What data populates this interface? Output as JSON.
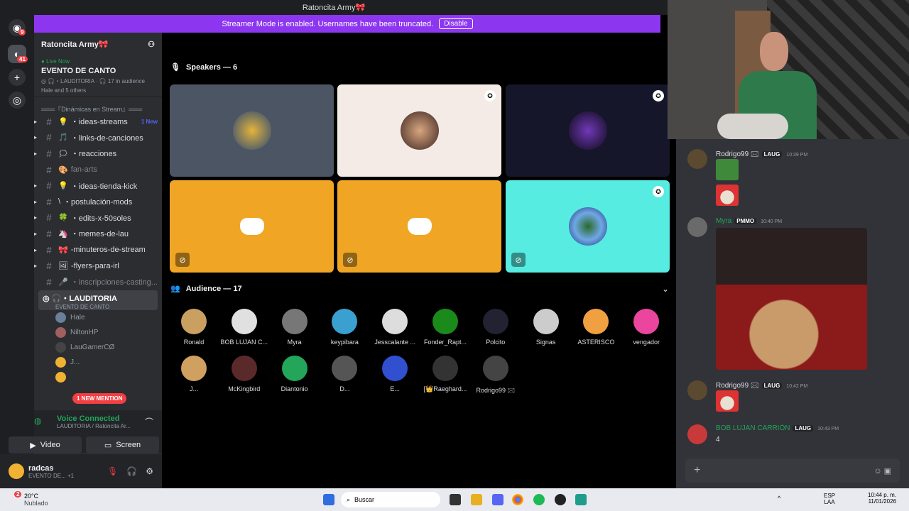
{
  "window": {
    "title": "Ratoncita Army🎀"
  },
  "streamer_banner": {
    "text": "Streamer Mode is enabled. Usernames have been truncated.",
    "button": "Disable"
  },
  "rail": {
    "home_badge": "9",
    "server_badge": "41"
  },
  "server": {
    "name": "Ratoncita Army🎀"
  },
  "live_event": {
    "status": "Live Now",
    "title": "EVENTO DE CANTO",
    "channel": "LAUDITORIA",
    "audience": "17 in audience",
    "attendees": "Hale and 5 others"
  },
  "category": {
    "label": "═══『Dinámicas en Stream』═══"
  },
  "channels": [
    {
      "name": "・ideas-streams",
      "badge": "1 New",
      "icon": "💡"
    },
    {
      "name": "・links-de-canciones",
      "icon": "🎵"
    },
    {
      "name": "・reacciones",
      "icon": "🗯"
    },
    {
      "name": "fan-arts",
      "icon": "🎨",
      "muted": true
    },
    {
      "name": "・ideas-tienda-kick",
      "icon": "💡"
    },
    {
      "name": "・postulación-mods",
      "icon": "\\"
    },
    {
      "name": "・edits-x-50soles",
      "icon": "🍀"
    },
    {
      "name": "・memes-de-lau",
      "icon": "🦄"
    },
    {
      "name": "-minuteros-de-stream",
      "icon": "🎀"
    },
    {
      "name": "-flyers-para-irl",
      "icon": "🖼"
    },
    {
      "name": "・inscripciones-casting...",
      "icon": "🎤",
      "muted": true
    }
  ],
  "voice_channel": {
    "name": "・LAUDITORIA",
    "sub": "EVENTO DE CANTO"
  },
  "voice_members": [
    "Hale",
    "NiltonHP",
    "LauGamerCØ",
    "J...",
    ""
  ],
  "mention_pill": "1 NEW MENTION",
  "voice_panel": {
    "status": "Voice Connected",
    "location": "LAUDITORIA / Ratoncita Ar...",
    "video": "Video",
    "screen": "Screen"
  },
  "user": {
    "name": "radcas",
    "status": "EVENTO DE... +1"
  },
  "speakers": {
    "label": "Speakers — 6"
  },
  "audience": {
    "label": "Audience — 17",
    "members": [
      "Ronald",
      "BOB LUJAN C...",
      "Myra",
      "keypibara",
      "Jesscalante ...",
      "Fonder_Rapt...",
      "Polcito",
      "Signas",
      "ASTERISCO",
      "vengador",
      "J...",
      "McKingbird",
      "Diantonio",
      "D...",
      "E...",
      "[👑Raeghard...",
      "Rodrigo99 🖂"
    ]
  },
  "chat": {
    "messages": [
      {
        "author": "Rodrigo99 🖂",
        "tag": "LAUG",
        "time": "10:39 PM"
      },
      {
        "author": "Myra",
        "tag": "PMMO",
        "time": "10:40 PM"
      },
      {
        "author": "Rodrigo99 🖂",
        "tag": "LAUG",
        "time": "10:42 PM"
      },
      {
        "author": "BOB LUJAN CARRIÓN",
        "tag": "LAUG",
        "time": "10:43 PM",
        "text": "4"
      }
    ]
  },
  "taskbar": {
    "weather_temp": "20°C",
    "weather_desc": "Nublado",
    "weather_badge": "2",
    "search": "Buscar",
    "lang_top": "ESP",
    "lang_bottom": "LAA",
    "time": "10:44 p. m.",
    "date": "11/01/2026"
  },
  "colors": {
    "accent": "#5865f2",
    "stream_purple": "#8d36f0",
    "online": "#23a55a",
    "danger": "#f23f43"
  }
}
